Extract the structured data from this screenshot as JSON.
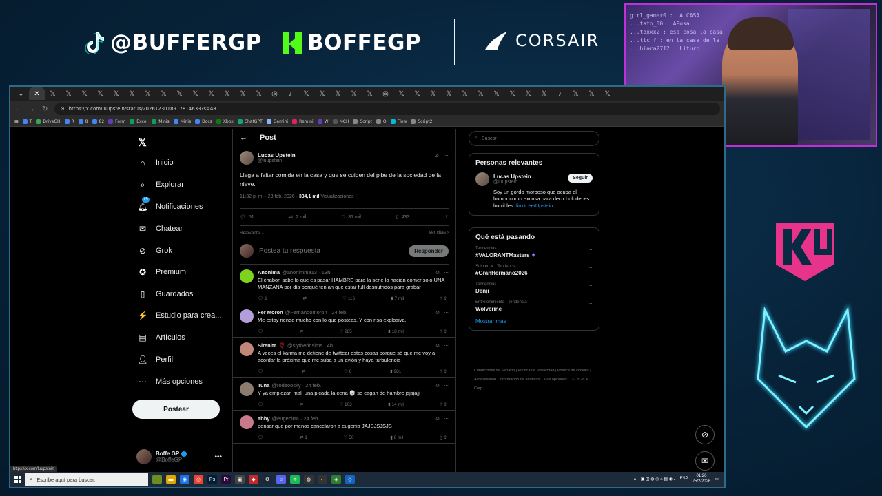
{
  "overlay": {
    "tiktok_handle": "@BUFFERGP",
    "kick_handle": "BOFFEGP",
    "sponsor": "CORSAIR",
    "webcam_chat": [
      "girl_gamer0 : LA CASA",
      "...tato_00 : APosa",
      "...toxxx2 : esa cosa la casa",
      "...ttc_f : en la casa de la",
      "...hiara2712 : Lituro"
    ]
  },
  "browser": {
    "url": "https://x.com/luupstein/status/2026123018917814633?s=48",
    "bookmarks": [
      "T",
      "DriveGH",
      "R",
      "8",
      "82",
      "Form",
      "Excel",
      "Minis",
      "Minis",
      "Docs",
      "Xbox",
      "ChatGPT",
      "Gemini",
      "Remini",
      "W",
      "MCH",
      "Script",
      "O",
      "Flow",
      "Script2"
    ],
    "status_url": "https://x.com/luupstein"
  },
  "nav": {
    "items": [
      {
        "label": "Inicio",
        "icon": "home-icon"
      },
      {
        "label": "Explorar",
        "icon": "search-icon"
      },
      {
        "label": "Notificaciones",
        "icon": "bell-icon",
        "badge": "15"
      },
      {
        "label": "Chatear",
        "icon": "mail-icon"
      },
      {
        "label": "Grok",
        "icon": "grok-icon"
      },
      {
        "label": "Premium",
        "icon": "premium-icon"
      },
      {
        "label": "Guardados",
        "icon": "bookmark-icon"
      },
      {
        "label": "Estudio para crea...",
        "icon": "studio-icon"
      },
      {
        "label": "Artículos",
        "icon": "article-icon"
      },
      {
        "label": "Perfil",
        "icon": "person-icon"
      },
      {
        "label": "Más opciones",
        "icon": "more-icon"
      }
    ],
    "post_button": "Postear",
    "profile_name": "Boffe GP",
    "profile_handle": "@BoffeGP"
  },
  "post": {
    "header": "Post",
    "author": "Lucas Upstein",
    "handle": "@luupstein",
    "text": "Llega a faltar comida en la casa y que se cuiden del pibe de la sociedad de la nieve.",
    "time": "11:32 p. m. · 23 feb. 2026 ·",
    "views": "334,1 mil",
    "views_label": "Visualizaciones",
    "replies": "51",
    "reposts": "2 mil",
    "likes": "31 mil",
    "bookmarks": "433",
    "sort_label": "Relevante",
    "quotes_label": "Ver citas",
    "reply_placeholder": "Postea tu respuesta",
    "reply_button": "Responder"
  },
  "replies": [
    {
      "name": "Anonima",
      "handle": "@anonimma13 · 13h",
      "text": "El chabon sabe lo que es pasar HAMBRE para la serie lo hacian comer solo UNA MANZANA por día porqué tenían que estar full desnutridos para grabar",
      "replies": "1",
      "reposts": "",
      "likes": "116",
      "views": "7 mil",
      "color": "#7ed321"
    },
    {
      "name": "Fer Moron",
      "handle": "@Fernandomoron · 24 feb.",
      "text": "Me estoy riendo mucho con lo que posteas. Y con risa explosiva.",
      "replies": "",
      "reposts": "",
      "likes": "285",
      "views": "18 mil",
      "color": "#b39ddb"
    },
    {
      "name": "Sirenita",
      "handle": "@slytherinsims · 4h",
      "text": "A veces el karma me detiene de twittear estas cosas porque sé que me voy a acordar la próxima que me suba a un avión y haya turbulencia",
      "replies": "",
      "reposts": "",
      "likes": "6",
      "views": "981",
      "color": "#c0877a"
    },
    {
      "name": "Tuna",
      "handle": "@rodeoosky · 24 feb.",
      "text": "Y ya empiezan mal, una picada la cena 💀 se cagan de hambre jsjsjajj",
      "replies": "",
      "reposts": "",
      "likes": "103",
      "views": "14 mil",
      "color": "#8c7b6f"
    },
    {
      "name": "abby",
      "handle": "@eugebirra · 24 feb.",
      "text": "pensar que por menos cancelaron a eugenia JAJSJSJSJS",
      "replies": "",
      "reposts": "1",
      "likes": "50",
      "views": "6 mil",
      "color": "#c97a8a"
    }
  ],
  "sidebar": {
    "search_placeholder": "Buscar",
    "relevant_title": "Personas relevantes",
    "rel_name": "Lucas Upstein",
    "rel_handle": "@luupstein",
    "follow": "Seguir",
    "rel_bio": "Soy un gordo morboso que ocupa el humor como excusa para decir boludeces horribles.",
    "rel_link": "linktr.ee/Upstein",
    "trending_title": "Qué está pasando",
    "trends": [
      {
        "cat": "Tendencias",
        "name": "#VALORANTMasters"
      },
      {
        "cat": "Solo en X · Tendencia",
        "name": "#GranHermano2026"
      },
      {
        "cat": "Tendencias",
        "name": "Denji"
      },
      {
        "cat": "Entretenimiento · Tendencia",
        "name": "Wolverine"
      }
    ],
    "show_more": "Mostrar más",
    "footer": "Condiciones de Servicio | Política de Privacidad | Política de cookies | Accesibilidad | Información de anuncios | Más opciones ... © 2026 X Corp."
  },
  "taskbar": {
    "search_placeholder": "Escribe aquí para buscar.",
    "lang": "ESP",
    "time": "01:26",
    "date": "25/2/2026"
  }
}
